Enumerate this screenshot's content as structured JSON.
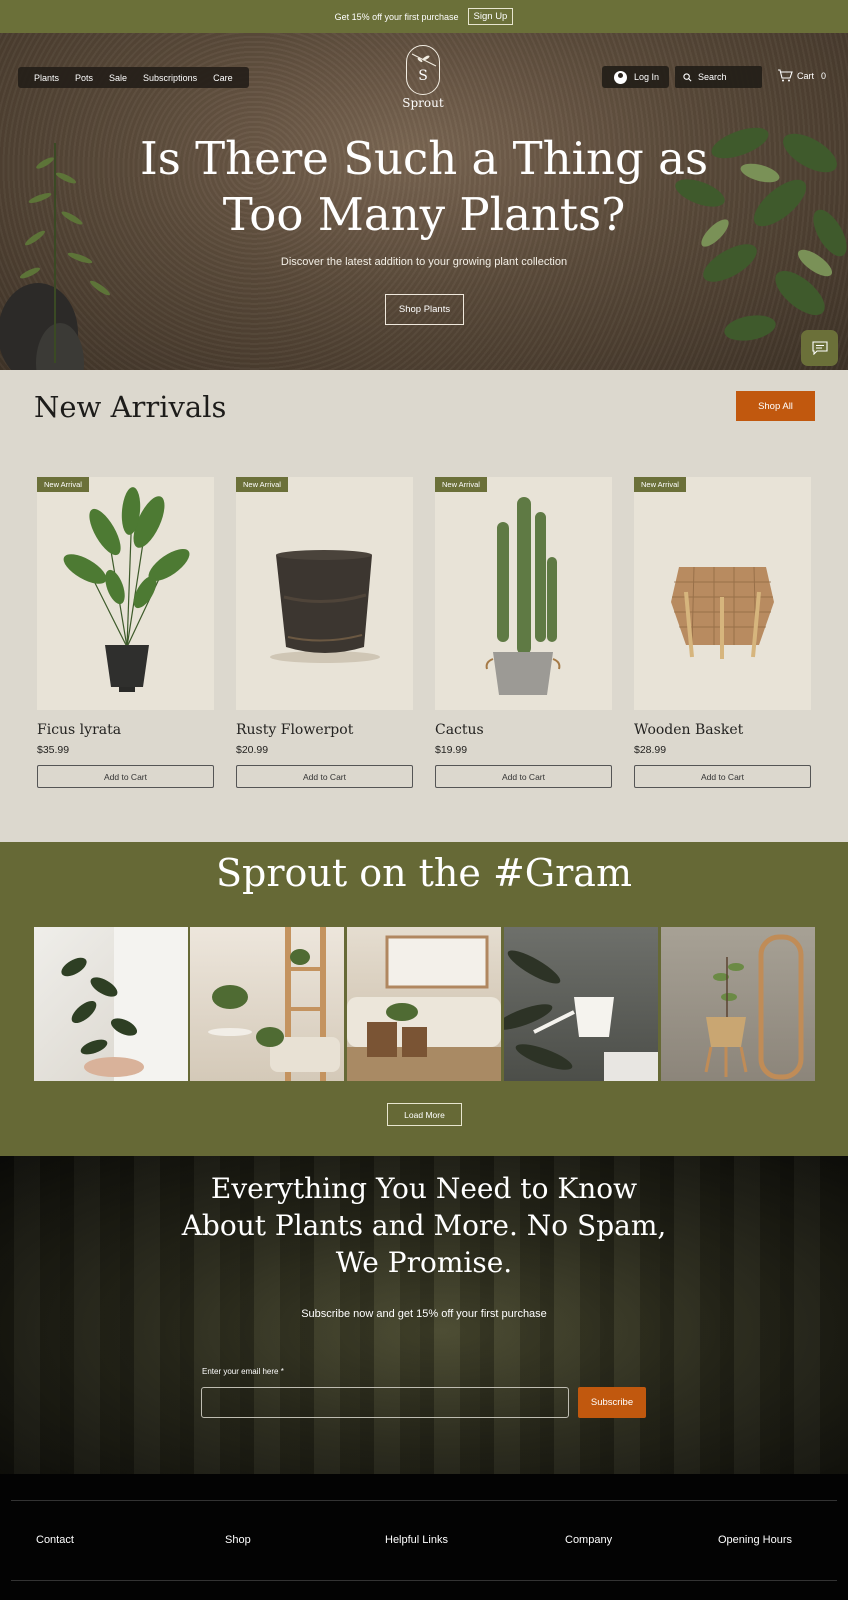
{
  "promo": {
    "text": "Get 15% off your first purchase",
    "signup": "Sign Up"
  },
  "nav": {
    "items": [
      "Plants",
      "Pots",
      "Sale",
      "Subscriptions",
      "Care"
    ]
  },
  "brand": {
    "letter": "S",
    "name": "Sprout"
  },
  "header": {
    "login": "Log In",
    "search_placeholder": "Search",
    "cart_label": "Cart",
    "cart_count": "0"
  },
  "hero": {
    "title_line1": "Is There Such a Thing as",
    "title_line2": "Too Many Plants?",
    "subtitle": "Discover the latest addition to your growing plant collection",
    "cta": "Shop Plants"
  },
  "arrivals": {
    "heading": "New Arrivals",
    "shop_all": "Shop All",
    "products": [
      {
        "badge": "New Arrival",
        "name": "Ficus lyrata",
        "price": "$35.99",
        "button": "Add to Cart"
      },
      {
        "badge": "New Arrival",
        "name": "Rusty Flowerpot",
        "price": "$20.99",
        "button": "Add to Cart"
      },
      {
        "badge": "New Arrival",
        "name": "Cactus",
        "price": "$19.99",
        "button": "Add to Cart"
      },
      {
        "badge": "New Arrival",
        "name": "Wooden Basket",
        "price": "$28.99",
        "button": "Add to Cart"
      }
    ]
  },
  "gram": {
    "heading": "Sprout on the #Gram",
    "load_more": "Load More"
  },
  "newsletter": {
    "line1": "Everything You Need to Know",
    "line2": "About Plants and More. No Spam,",
    "line3": "We Promise.",
    "subtitle": "Subscribe now and get 15% off your first purchase",
    "field_label": "Enter your email here *",
    "button": "Subscribe"
  },
  "footer": {
    "columns": [
      "Contact",
      "Shop",
      "Helpful Links",
      "Company",
      "Opening Hours"
    ]
  },
  "colors": {
    "olive": "#6b7039",
    "accent": "#c1580e",
    "cream": "#dcd8ce"
  }
}
